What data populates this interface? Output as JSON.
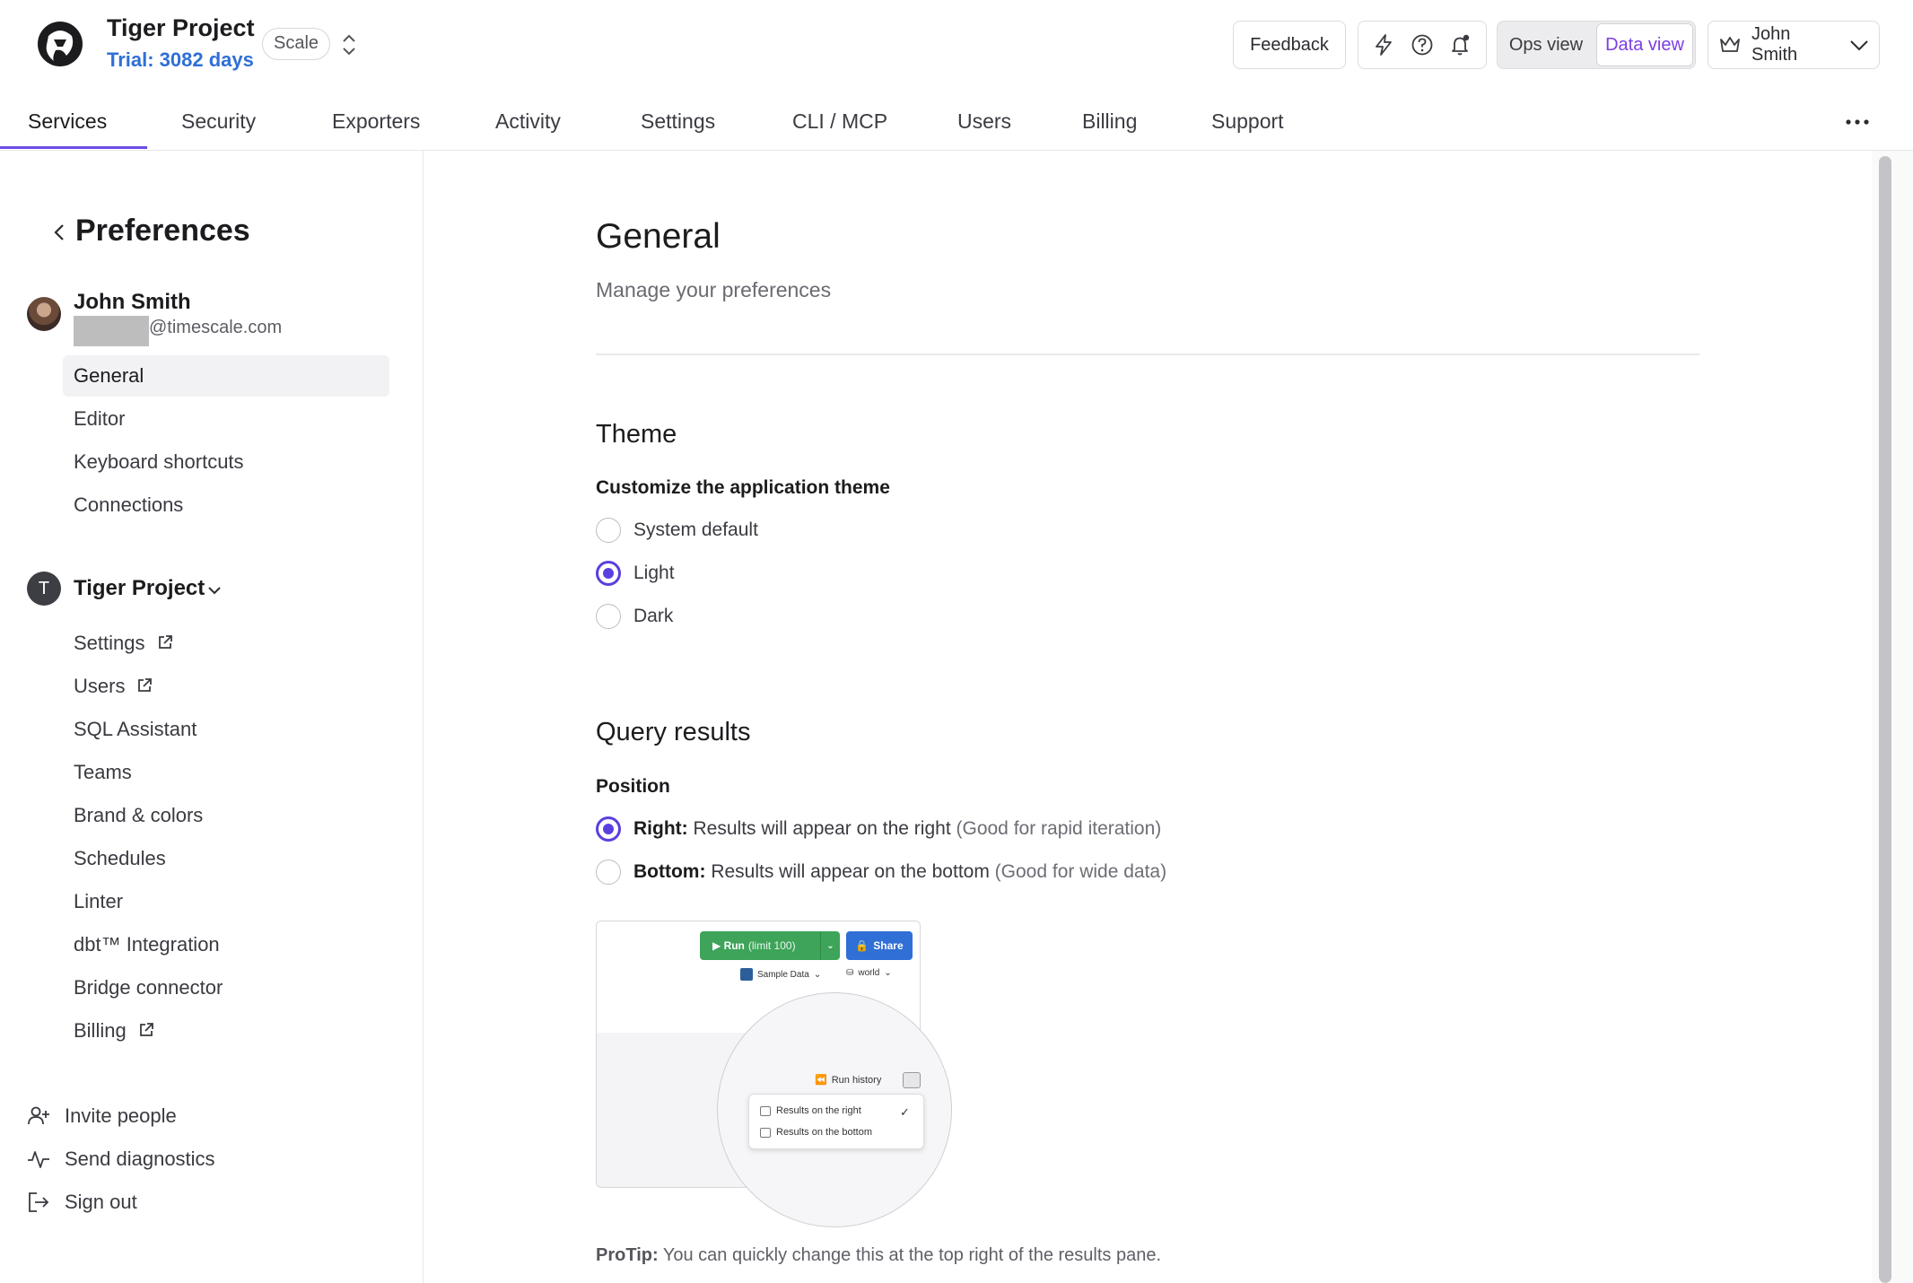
{
  "header": {
    "project_name": "Tiger Project",
    "trial": "Trial: 3082 days",
    "plan_badge": "Scale",
    "feedback_label": "Feedback",
    "ops_view_label": "Ops view",
    "data_view_label": "Data view",
    "user_name": "John Smith",
    "icons": [
      "logo-icon",
      "lightning-icon",
      "help-icon",
      "bell-icon",
      "crown-icon",
      "chevron-down-icon"
    ]
  },
  "tabs": [
    {
      "label": "Services",
      "active": true
    },
    {
      "label": "Security"
    },
    {
      "label": "Exporters"
    },
    {
      "label": "Activity"
    },
    {
      "label": "Settings"
    },
    {
      "label": "CLI / MCP"
    },
    {
      "label": "Users"
    },
    {
      "label": "Billing"
    },
    {
      "label": "Support"
    }
  ],
  "sidebar": {
    "title": "Preferences",
    "user_name": "John Smith",
    "email_domain": "@timescale.com",
    "pref_items": [
      {
        "label": "General",
        "active": true
      },
      {
        "label": "Editor"
      },
      {
        "label": "Keyboard shortcuts"
      },
      {
        "label": "Connections"
      }
    ],
    "project_initial": "T",
    "project_name": "Tiger Project",
    "project_items": [
      {
        "label": "Settings",
        "external": true
      },
      {
        "label": "Users",
        "external": true
      },
      {
        "label": "SQL Assistant"
      },
      {
        "label": "Teams"
      },
      {
        "label": "Brand & colors"
      },
      {
        "label": "Schedules"
      },
      {
        "label": "Linter"
      },
      {
        "label": "dbt™ Integration"
      },
      {
        "label": "Bridge connector"
      },
      {
        "label": "Billing",
        "external": true
      }
    ],
    "bottom_links": [
      {
        "label": "Invite people",
        "icon": "user-plus-icon"
      },
      {
        "label": "Send diagnostics",
        "icon": "activity-icon"
      },
      {
        "label": "Sign out",
        "icon": "sign-out-icon"
      }
    ]
  },
  "main": {
    "title": "General",
    "subtitle": "Manage your preferences",
    "theme": {
      "title": "Theme",
      "label": "Customize the application theme",
      "options": [
        {
          "label": "System default",
          "checked": false
        },
        {
          "label": "Light",
          "checked": true
        },
        {
          "label": "Dark",
          "checked": false
        }
      ]
    },
    "query_results": {
      "title": "Query results",
      "label": "Position",
      "options": [
        {
          "label": "Right:",
          "desc": "Results will appear on the right",
          "hint": "(Good for rapid iteration)",
          "checked": true
        },
        {
          "label": "Bottom:",
          "desc": "Results will appear on the bottom",
          "hint": "(Good for wide data)",
          "checked": false
        }
      ]
    },
    "preview": {
      "run_label": "Run",
      "run_limit": "(limit 100)",
      "share_label": "Share",
      "sample_data": "Sample Data",
      "world": "world",
      "run_history": "Run history",
      "popup_right": "Results on the right",
      "popup_bottom": "Results on the bottom",
      "check": "✓"
    },
    "protip_label": "ProTip:",
    "protip_text": "You can quickly change this at the top right of the results pane."
  },
  "colors": {
    "accent": "#5b3fe0",
    "trial": "#2f6fd6",
    "data_view": "#7b3fe4",
    "run_green": "#3da45a",
    "share_blue": "#2f6fd6"
  }
}
